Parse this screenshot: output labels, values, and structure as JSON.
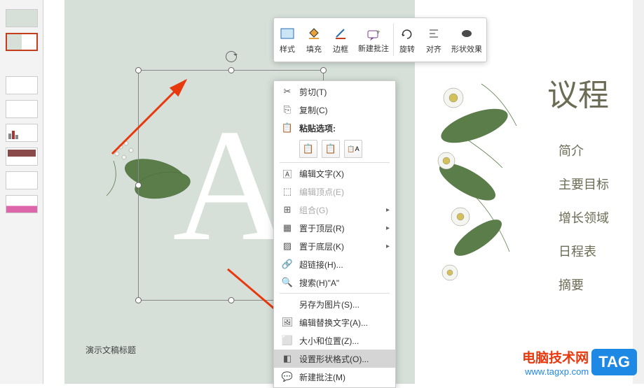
{
  "slide_placeholder": "演示文稿标题",
  "letter": "A",
  "thumbnails": [
    {
      "type": "cover"
    },
    {
      "type": "agenda"
    },
    {
      "type": "gap"
    },
    {
      "type": "text"
    },
    {
      "type": "text"
    },
    {
      "type": "chart"
    },
    {
      "type": "chart2"
    },
    {
      "type": "text2"
    },
    {
      "type": "footer"
    }
  ],
  "mini_toolbar": {
    "style": "样式",
    "fill": "填充",
    "outline": "边框",
    "new_comment": "新建批注",
    "rotate": "旋转",
    "align": "对齐",
    "effects": "形状效果"
  },
  "context_menu": {
    "cut": "剪切(T)",
    "copy": "复制(C)",
    "paste_options": "粘贴选项:",
    "edit_text": "编辑文字(X)",
    "edit_points": "编辑顶点(E)",
    "group": "组合(G)",
    "bring_front": "置于顶层(R)",
    "send_back": "置于底层(K)",
    "hyperlink": "超链接(H)...",
    "search": "搜索(H)\"A\"",
    "save_as_picture": "另存为图片(S)...",
    "alt_text": "编辑替换文字(A)...",
    "size_position": "大小和位置(Z)...",
    "format_shape": "设置形状格式(O)...",
    "new_comment": "新建批注(M)"
  },
  "agenda": {
    "title": "议程",
    "items": [
      "简介",
      "主要目标",
      "增长领域",
      "日程表",
      "摘要"
    ]
  },
  "watermark": {
    "line1": "电脑技术网",
    "line2": "www.tagxp.com",
    "badge": "TAG"
  }
}
